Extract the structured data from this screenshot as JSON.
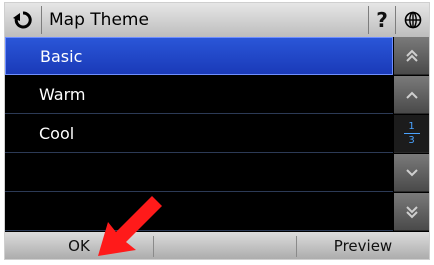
{
  "header": {
    "title": "Map Theme",
    "back_icon": "refresh-back-icon",
    "help_label": "?",
    "globe_icon": "globe-icon"
  },
  "list": {
    "items": [
      {
        "label": "Basic",
        "selected": true
      },
      {
        "label": "Warm",
        "selected": false
      },
      {
        "label": "Cool",
        "selected": false
      },
      {
        "label": "",
        "selected": false
      },
      {
        "label": "",
        "selected": false
      }
    ]
  },
  "pager": {
    "current": "1",
    "total": "3"
  },
  "footer": {
    "ok_label": "OK",
    "preview_label": "Preview"
  },
  "colors": {
    "selected_row": "#2a56d8",
    "accent_blue": "#4aa3ff",
    "annotation_arrow": "#ff0000"
  }
}
